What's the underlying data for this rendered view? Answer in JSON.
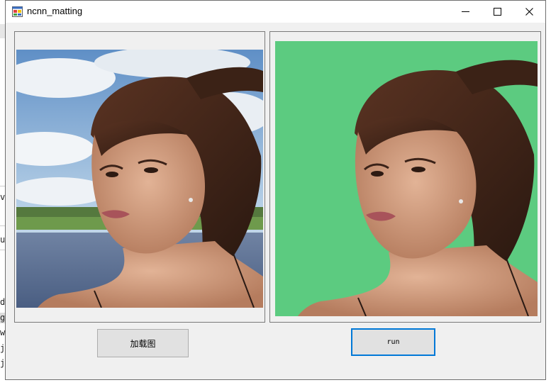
{
  "window": {
    "title": "ncnn_matting",
    "controls": {
      "minimize_icon": "minimize-icon",
      "maximize_icon": "maximize-icon",
      "close_icon": "close-icon"
    }
  },
  "buttons": {
    "load_label": "加载图",
    "run_label": "run"
  },
  "panels": {
    "original": {
      "content": "portrait photo of a woman outdoors with sky, trees and water background"
    },
    "result": {
      "content": "matted portrait on green background",
      "background_color": "#5ccb80"
    }
  },
  "background_window": {
    "edge_chars": [
      "v",
      "u",
      "d",
      "g",
      "w",
      "ji",
      "j"
    ]
  },
  "colors": {
    "window_bg": "#f0f0f0",
    "accent": "#0078d7",
    "matte_green": "#5ccb80"
  }
}
